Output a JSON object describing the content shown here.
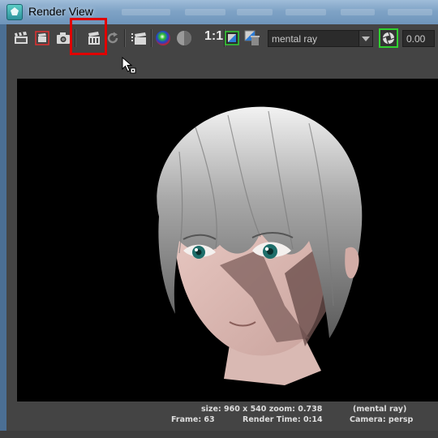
{
  "window": {
    "title": "Render View"
  },
  "toolbar": {
    "buttons": [
      {
        "name": "redo-previous-render",
        "icon": "clapboard-icon"
      },
      {
        "name": "render-region",
        "icon": "clapboard-region-icon"
      },
      {
        "name": "snapshot",
        "icon": "camera-icon"
      },
      {
        "name": "ipr-render",
        "icon": "ipr-clapboard-icon",
        "highlighted": true
      },
      {
        "name": "refresh-ipr",
        "icon": "refresh-icon"
      },
      {
        "name": "render-sequence",
        "icon": "clapboard-sequence-icon"
      },
      {
        "name": "display-rgb-channels",
        "icon": "rgb-channels-icon"
      },
      {
        "name": "display-alpha-channel",
        "icon": "alpha-channel-icon"
      },
      {
        "name": "keep-image",
        "icon": "keep-image-icon"
      },
      {
        "name": "remove-image",
        "icon": "remove-image-icon"
      }
    ],
    "ratio_label": "1:1",
    "renderer": "mental ray",
    "exposure_value": "0.00"
  },
  "status": {
    "size_zoom": "size: 960 x 540 zoom: 0.738",
    "renderer": "(mental ray)",
    "frame": "Frame: 63",
    "render_time": "Render Time: 0:14",
    "camera": "Camera: persp"
  },
  "colors": {
    "panel": "#444444",
    "viewport": "#000000",
    "highlight": "#e00000",
    "exposure_border": "#2fd12f"
  }
}
